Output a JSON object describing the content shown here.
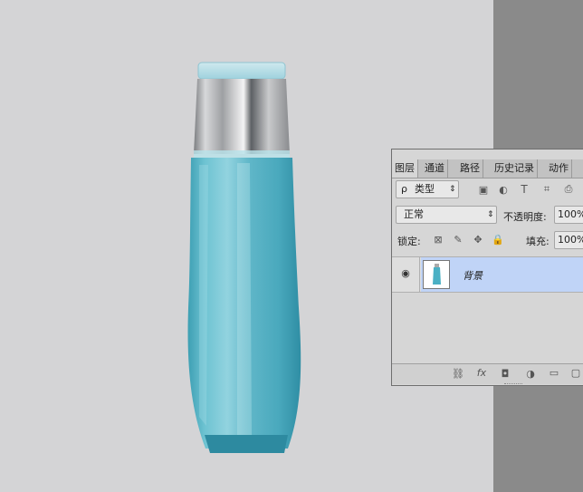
{
  "layers_panel": {
    "tabs": [
      "图层",
      "通道",
      "路径",
      "历史记录",
      "动作"
    ],
    "filter": {
      "label": "类型",
      "search_glyph": "ρ"
    },
    "blend_mode": "正常",
    "opacity_label": "不透明度:",
    "opacity_value": "100%",
    "lock_label": "锁定:",
    "fill_label": "填充:",
    "fill_value": "100%",
    "layers": [
      {
        "name": "背景",
        "visible": true,
        "selected": true
      }
    ],
    "filter_icons": [
      "image-filter-icon",
      "adjustment-filter-icon",
      "text-filter-icon",
      "shape-filter-icon",
      "smart-object-filter-icon"
    ],
    "lock_icons": [
      "lock-transparent-icon",
      "lock-image-icon",
      "lock-position-icon",
      "lock-all-icon"
    ],
    "bottom_icons": [
      "link-layers-icon",
      "fx-icon",
      "add-mask-icon",
      "adjustment-layer-icon",
      "new-group-icon",
      "new-layer-icon"
    ],
    "fx_text": "fx",
    "colors": {
      "selected_row": "#c0d4f7",
      "panel_bg": "#d6d6d6"
    }
  }
}
